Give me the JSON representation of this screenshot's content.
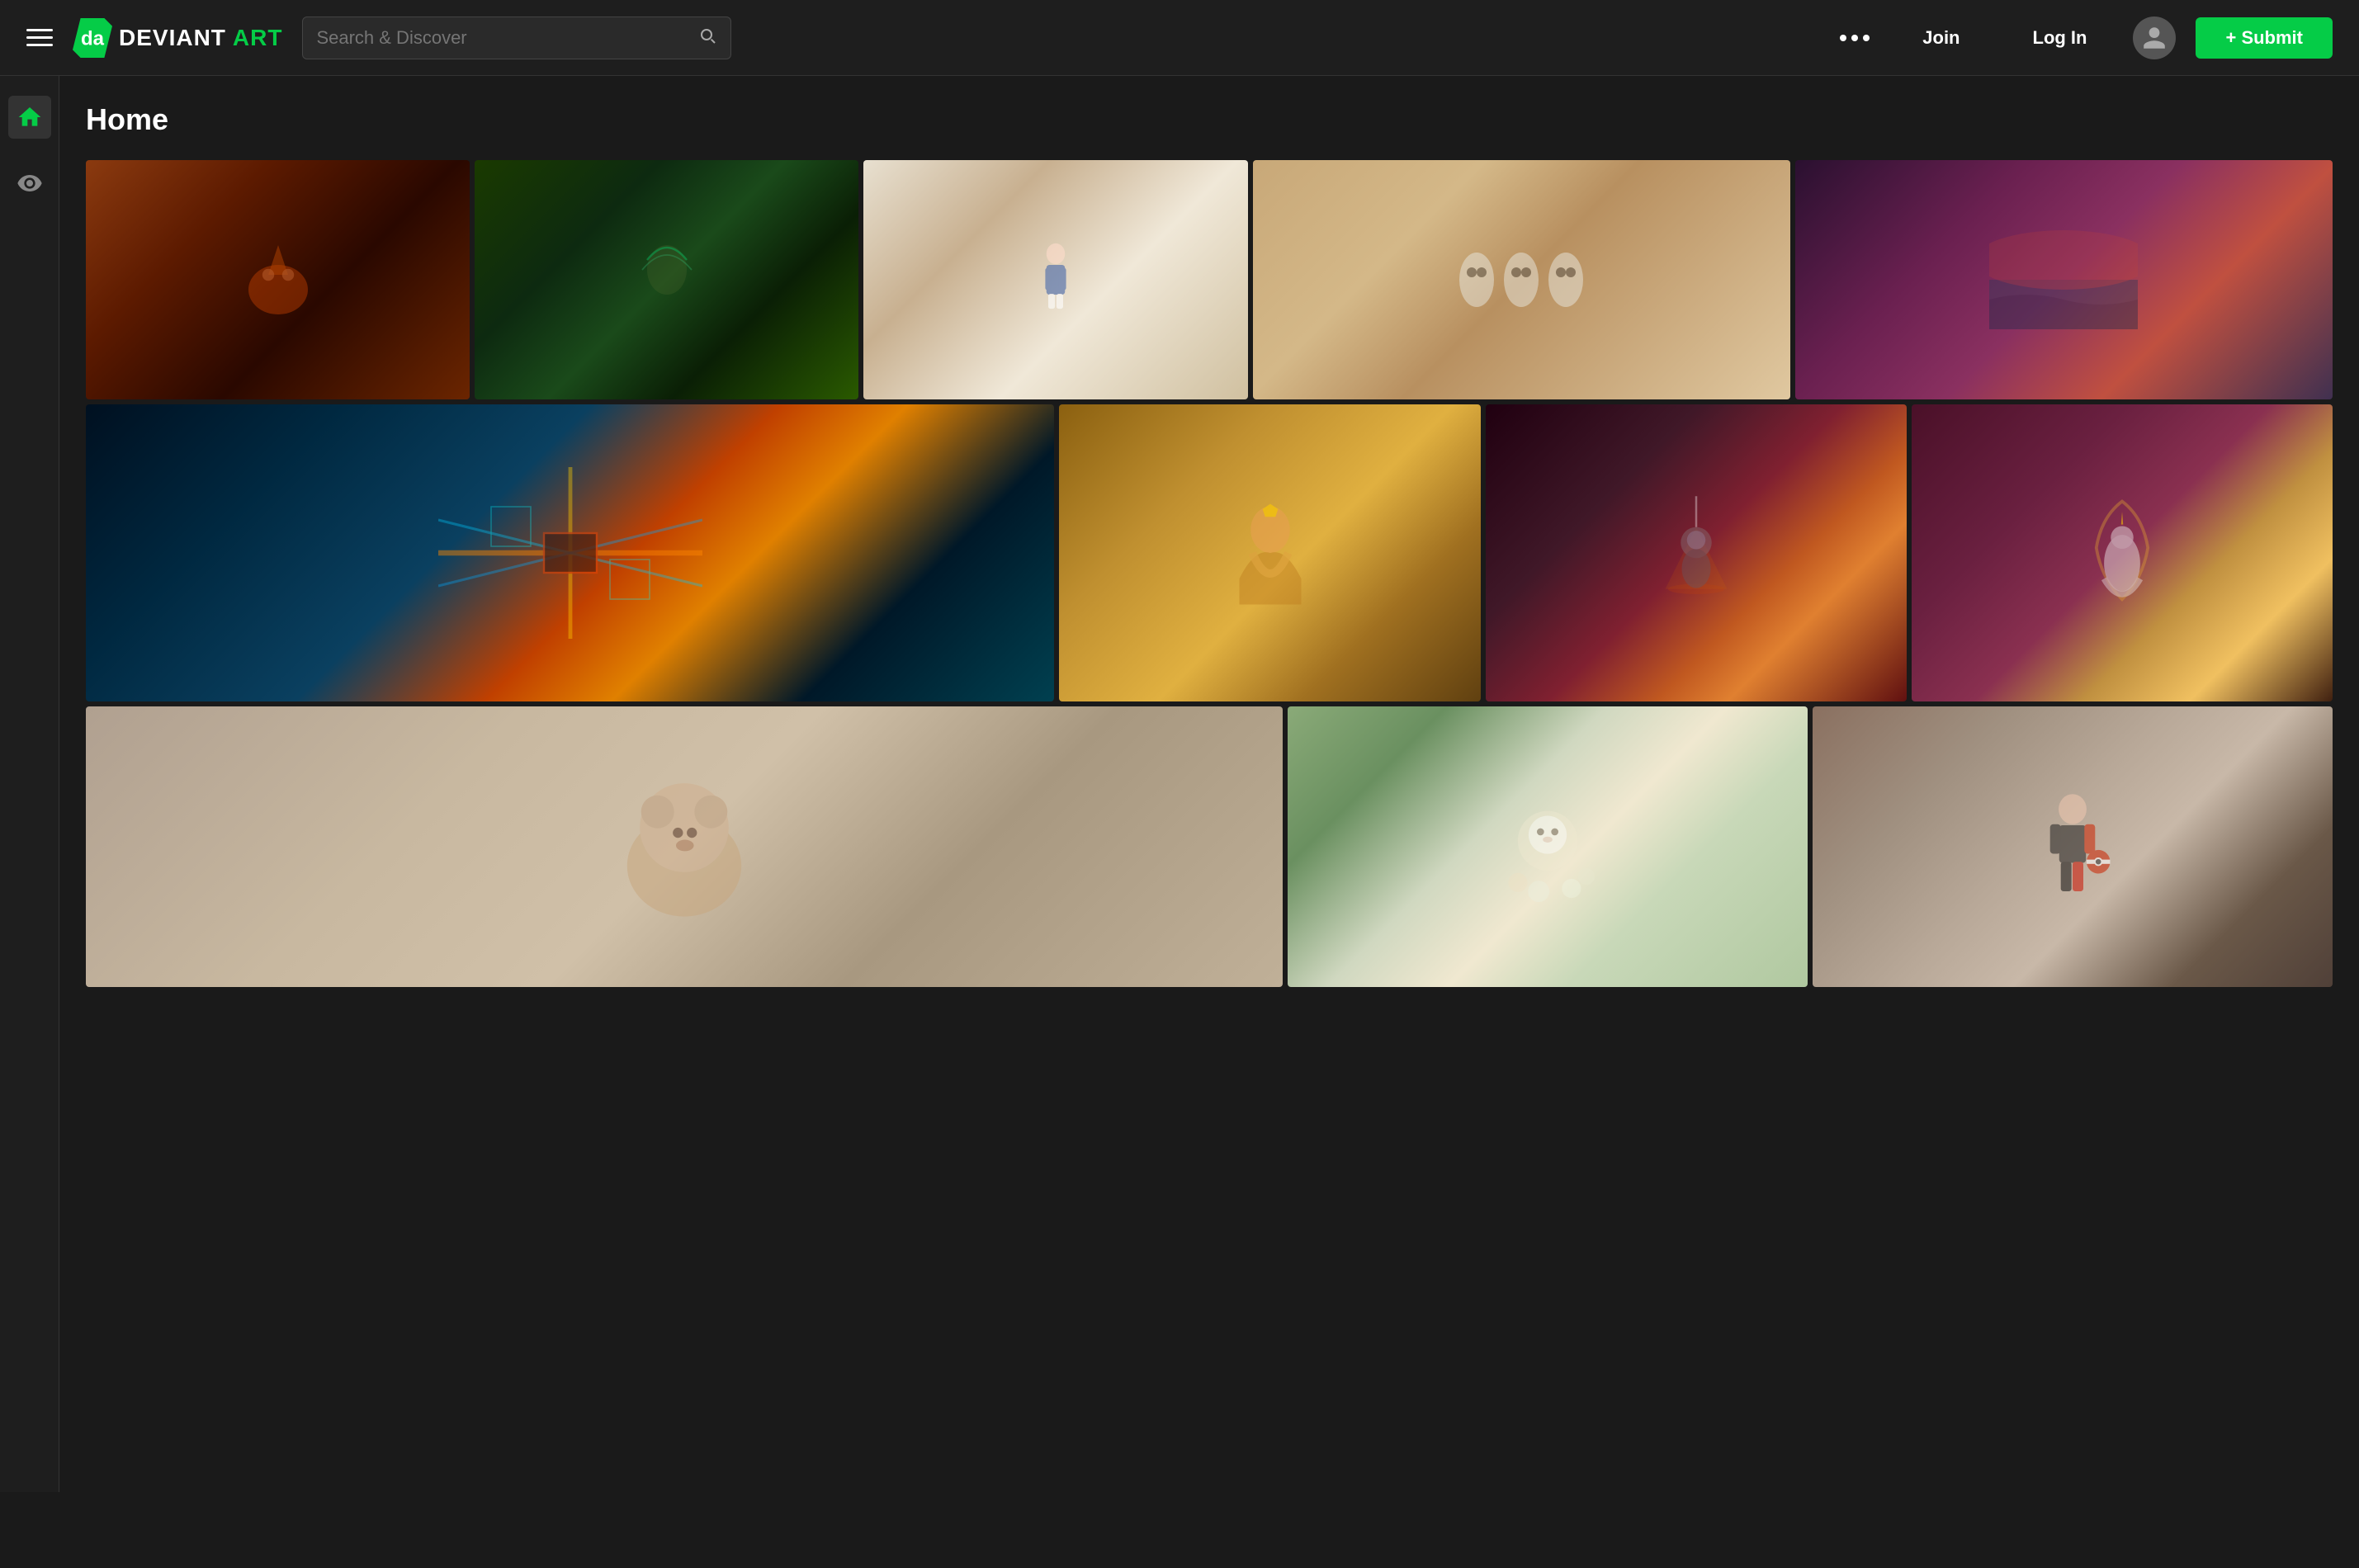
{
  "nav": {
    "hamburger_label": "Menu",
    "logo_text": "DEVIANT",
    "logo_text2": "ART",
    "search_placeholder": "Search & Discover",
    "dots_label": "More",
    "join_label": "Join",
    "login_label": "Log In",
    "submit_label": "+ Submit"
  },
  "sidebar": {
    "home_label": "Home",
    "watch_label": "Watch"
  },
  "main": {
    "page_title": "Home"
  },
  "gallery": {
    "rows": [
      {
        "items": [
          {
            "id": "dragon",
            "art_class": "art-dragon",
            "span": 1
          },
          {
            "id": "wolf",
            "art_class": "art-wolf",
            "span": 1
          },
          {
            "id": "alice",
            "art_class": "art-alice",
            "span": 1
          },
          {
            "id": "owls",
            "art_class": "art-owls",
            "span": 1
          },
          {
            "id": "coast",
            "art_class": "art-coast",
            "span": 1
          }
        ]
      },
      {
        "items": [
          {
            "id": "circuit",
            "art_class": "art-circuit",
            "span": 2
          },
          {
            "id": "princess",
            "art_class": "art-princess",
            "span": 1
          },
          {
            "id": "space",
            "art_class": "art-space",
            "span": 1
          },
          {
            "id": "unicorn",
            "art_class": "art-unicorn",
            "span": 1
          }
        ]
      },
      {
        "items": [
          {
            "id": "bear",
            "art_class": "art-bear",
            "span": 2
          },
          {
            "id": "lion-flowers",
            "art_class": "art-lion-flowers",
            "span": 1
          },
          {
            "id": "pokemon",
            "art_class": "art-pokemon",
            "span": 1
          }
        ]
      }
    ]
  }
}
